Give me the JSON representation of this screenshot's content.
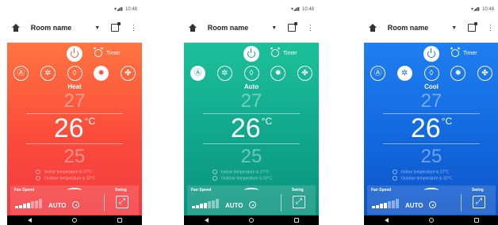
{
  "status_time": "10:48",
  "nav": {
    "room_name": "Room name"
  },
  "labels": {
    "timer": "Timer",
    "fan_speed": "Fan Speed",
    "swing": "Swing",
    "fan_mode": "AUTO",
    "indoor": "Indoor temperature is 27°C",
    "outdoor": "Outdoor temperature is 32°C",
    "temp_unit": "°C"
  },
  "mode_icons": [
    "auto-icon",
    "dry-icon",
    "water-drop-icon",
    "sun-icon",
    "fan-icon"
  ],
  "mode_glyphs": [
    "Ⓐ",
    "✲",
    "◊",
    "✹",
    "✤"
  ],
  "colors": {
    "heat": "#fb4b3b",
    "auto": "#0fa48a",
    "cool": "#1266dc"
  },
  "fan_speed_level": 0.6,
  "panels": [
    {
      "mode": "Heat",
      "active_mode_index": 3,
      "temp_up": "27",
      "temp_current": "26",
      "temp_down": "25"
    },
    {
      "mode": "Auto",
      "active_mode_index": 0,
      "temp_up": "27",
      "temp_current": "26",
      "temp_down": "25"
    },
    {
      "mode": "Cool",
      "active_mode_index": 1,
      "temp_up": "27",
      "temp_current": "26",
      "temp_down": "25"
    }
  ]
}
